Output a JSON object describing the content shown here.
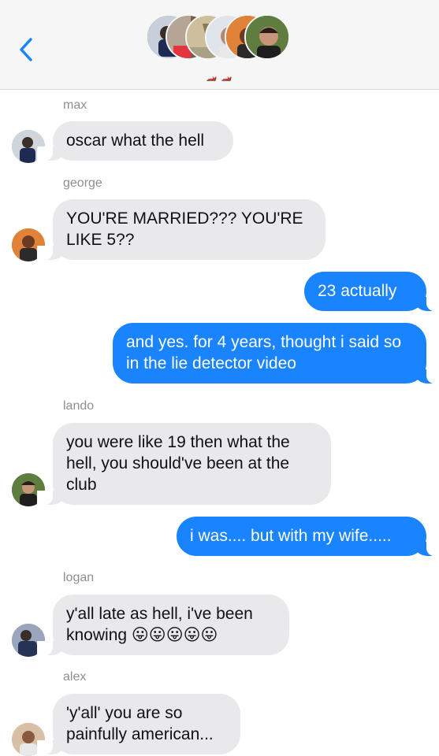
{
  "header": {
    "group_name": "🏎️ 🏎️",
    "avatar_icons": [
      "avatar-1",
      "avatar-2",
      "avatar-3",
      "avatar-4",
      "avatar-5",
      "avatar-6"
    ]
  },
  "messages": [
    {
      "sender": "max",
      "text": "oscar what the hell"
    },
    {
      "sender": "george",
      "text": "YOU'RE MARRIED??? YOU'RE LIKE 5??"
    },
    {
      "text": "23 actually"
    },
    {
      "text": "and yes. for 4 years, thought i said so in the lie detector video"
    },
    {
      "sender": "lando",
      "text": "you were like 19 then what the hell, you should've been at the club"
    },
    {
      "text": "i was.... but with my wife....."
    },
    {
      "sender": "logan",
      "text": "y'all late as hell, i've been knowing",
      "emoji": "😛😛😛😛😛"
    },
    {
      "sender": "alex",
      "text": "'y'all' you are so painfully american..."
    }
  ]
}
